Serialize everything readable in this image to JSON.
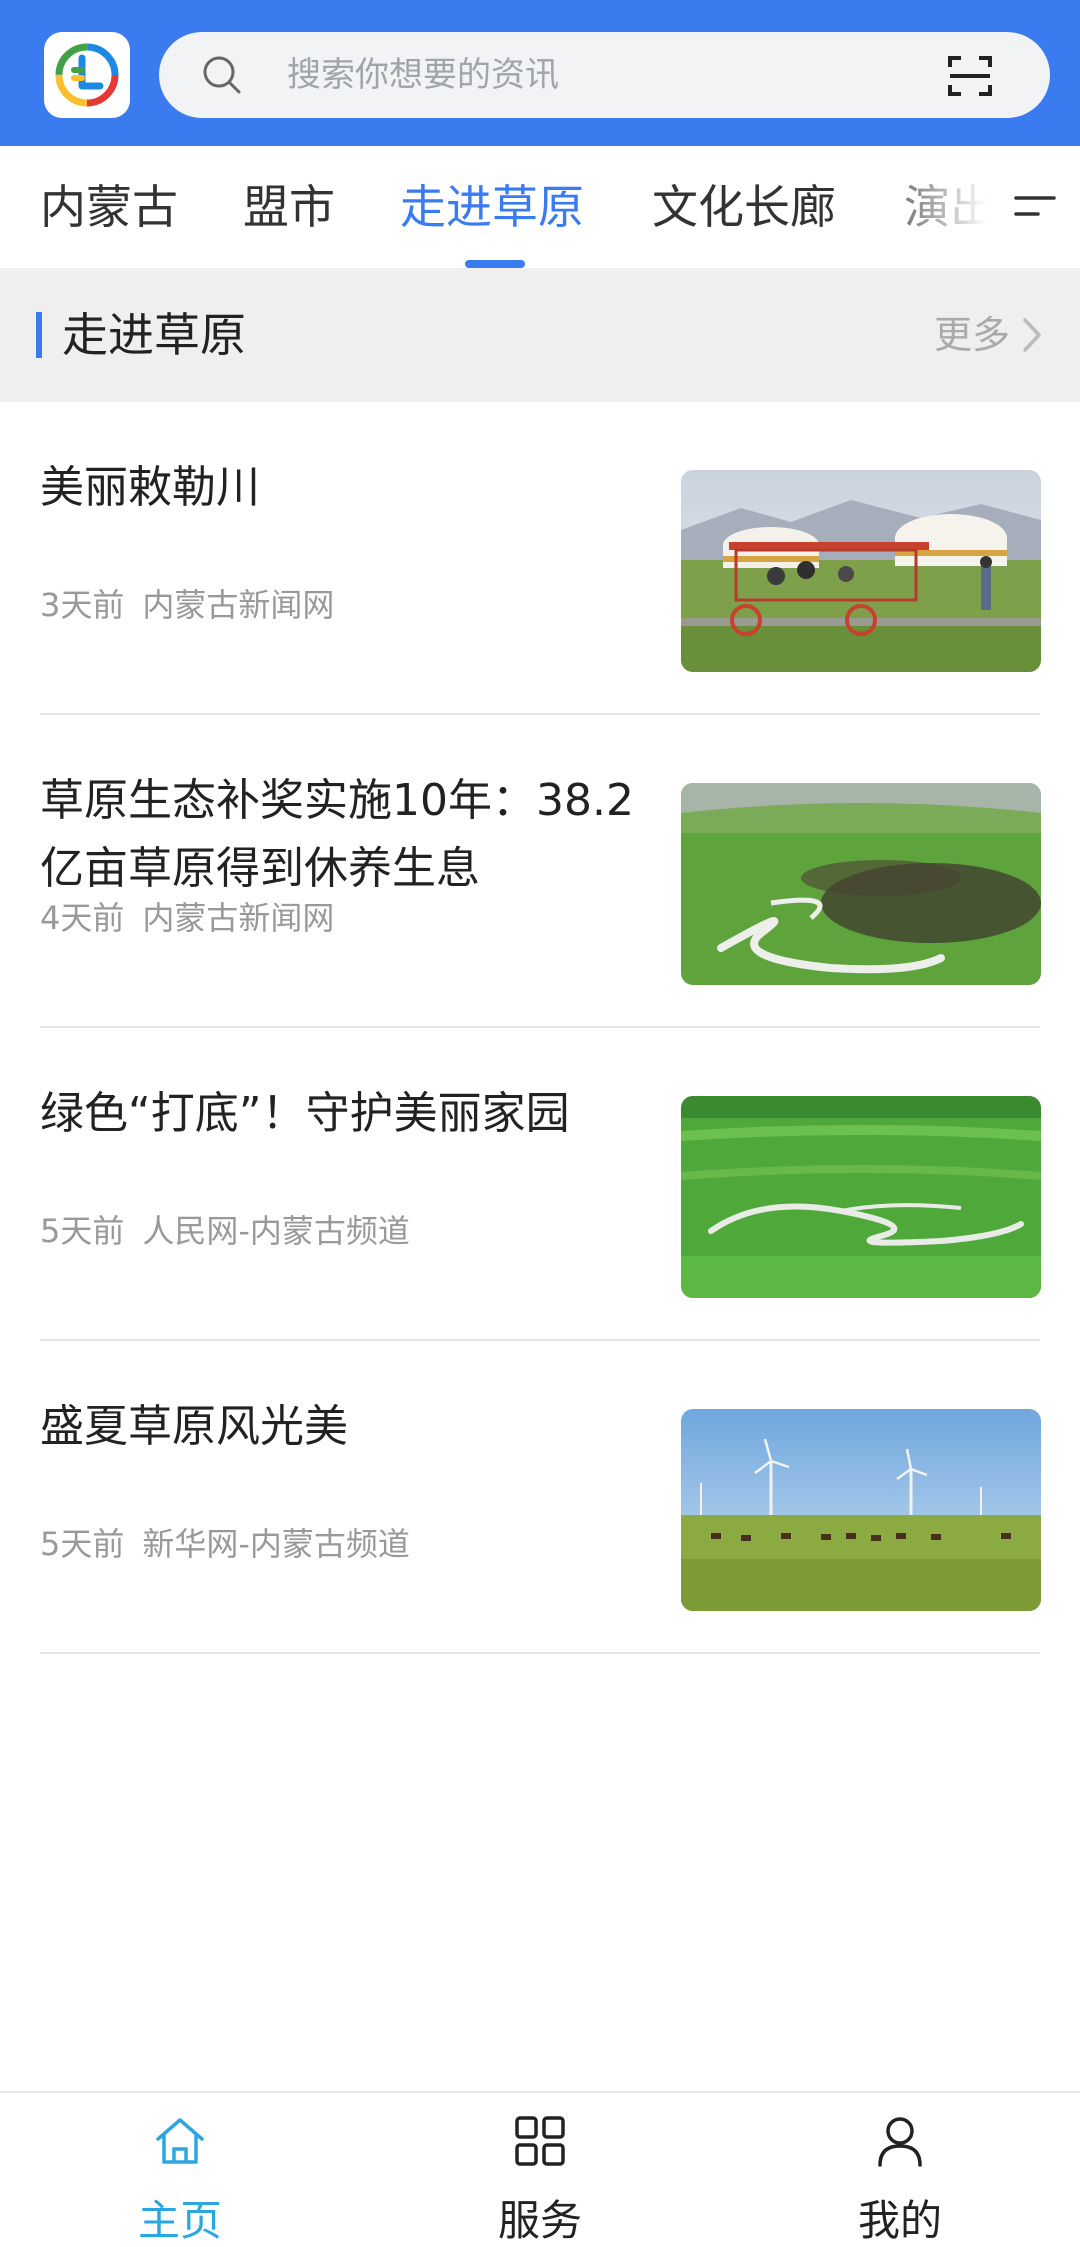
{
  "header": {
    "search_placeholder": "搜索你想要的资讯",
    "accent_color": "#3B7BF0",
    "logo_icon": "app-logo-icon",
    "search_icon": "search-icon",
    "scan_icon": "scan-icon"
  },
  "tabs": [
    {
      "label": "内蒙古",
      "active": false
    },
    {
      "label": "盟市",
      "active": false
    },
    {
      "label": "走进草原",
      "active": true
    },
    {
      "label": "文化长廊",
      "active": false
    },
    {
      "label": "演出",
      "active": false
    }
  ],
  "tabs_menu_icon": "menu-icon",
  "section": {
    "title": "走进草原",
    "more_label": "更多"
  },
  "news": [
    {
      "title": "美丽敕勒川",
      "time": "3天前",
      "source": "内蒙古新闻网",
      "thumb": "yurts and tourists on a surrey bike on grassland"
    },
    {
      "title": "草原生态补奖实施10年：38.2亿亩草原得到休养生息",
      "time": "4天前",
      "source": "内蒙古新闻网",
      "thumb": "herd of horses beside a winding river on green grassland"
    },
    {
      "title": "绿色“打底”！守护美丽家园",
      "time": "5天前",
      "source": "人民网-内蒙古频道",
      "thumb": "winding river across vast green grassland"
    },
    {
      "title": "盛夏草原风光美",
      "time": "5天前",
      "source": "新华网-内蒙古频道",
      "thumb": "horses grazing under wind turbines on grassland"
    }
  ],
  "bottom_nav": [
    {
      "label": "主页",
      "icon": "home-icon",
      "active": true
    },
    {
      "label": "服务",
      "icon": "grid-icon",
      "active": false
    },
    {
      "label": "我的",
      "icon": "user-icon",
      "active": false
    }
  ]
}
